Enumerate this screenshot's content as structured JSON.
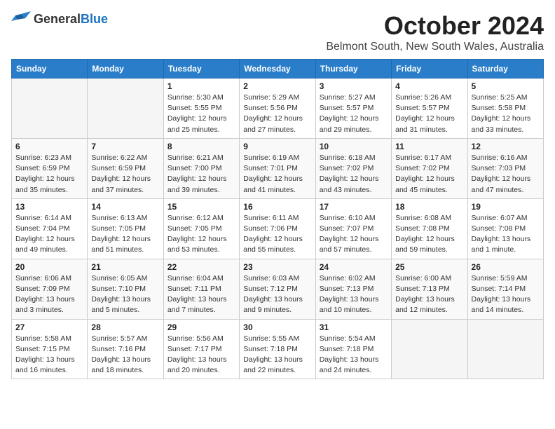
{
  "header": {
    "logo_general": "General",
    "logo_blue": "Blue",
    "title": "October 2024",
    "subtitle": "Belmont South, New South Wales, Australia"
  },
  "days_of_week": [
    "Sunday",
    "Monday",
    "Tuesday",
    "Wednesday",
    "Thursday",
    "Friday",
    "Saturday"
  ],
  "weeks": [
    [
      {
        "day": "",
        "sunrise": "",
        "sunset": "",
        "daylight": ""
      },
      {
        "day": "",
        "sunrise": "",
        "sunset": "",
        "daylight": ""
      },
      {
        "day": "1",
        "sunrise": "Sunrise: 5:30 AM",
        "sunset": "Sunset: 5:55 PM",
        "daylight": "Daylight: 12 hours and 25 minutes."
      },
      {
        "day": "2",
        "sunrise": "Sunrise: 5:29 AM",
        "sunset": "Sunset: 5:56 PM",
        "daylight": "Daylight: 12 hours and 27 minutes."
      },
      {
        "day": "3",
        "sunrise": "Sunrise: 5:27 AM",
        "sunset": "Sunset: 5:57 PM",
        "daylight": "Daylight: 12 hours and 29 minutes."
      },
      {
        "day": "4",
        "sunrise": "Sunrise: 5:26 AM",
        "sunset": "Sunset: 5:57 PM",
        "daylight": "Daylight: 12 hours and 31 minutes."
      },
      {
        "day": "5",
        "sunrise": "Sunrise: 5:25 AM",
        "sunset": "Sunset: 5:58 PM",
        "daylight": "Daylight: 12 hours and 33 minutes."
      }
    ],
    [
      {
        "day": "6",
        "sunrise": "Sunrise: 6:23 AM",
        "sunset": "Sunset: 6:59 PM",
        "daylight": "Daylight: 12 hours and 35 minutes."
      },
      {
        "day": "7",
        "sunrise": "Sunrise: 6:22 AM",
        "sunset": "Sunset: 6:59 PM",
        "daylight": "Daylight: 12 hours and 37 minutes."
      },
      {
        "day": "8",
        "sunrise": "Sunrise: 6:21 AM",
        "sunset": "Sunset: 7:00 PM",
        "daylight": "Daylight: 12 hours and 39 minutes."
      },
      {
        "day": "9",
        "sunrise": "Sunrise: 6:19 AM",
        "sunset": "Sunset: 7:01 PM",
        "daylight": "Daylight: 12 hours and 41 minutes."
      },
      {
        "day": "10",
        "sunrise": "Sunrise: 6:18 AM",
        "sunset": "Sunset: 7:02 PM",
        "daylight": "Daylight: 12 hours and 43 minutes."
      },
      {
        "day": "11",
        "sunrise": "Sunrise: 6:17 AM",
        "sunset": "Sunset: 7:02 PM",
        "daylight": "Daylight: 12 hours and 45 minutes."
      },
      {
        "day": "12",
        "sunrise": "Sunrise: 6:16 AM",
        "sunset": "Sunset: 7:03 PM",
        "daylight": "Daylight: 12 hours and 47 minutes."
      }
    ],
    [
      {
        "day": "13",
        "sunrise": "Sunrise: 6:14 AM",
        "sunset": "Sunset: 7:04 PM",
        "daylight": "Daylight: 12 hours and 49 minutes."
      },
      {
        "day": "14",
        "sunrise": "Sunrise: 6:13 AM",
        "sunset": "Sunset: 7:05 PM",
        "daylight": "Daylight: 12 hours and 51 minutes."
      },
      {
        "day": "15",
        "sunrise": "Sunrise: 6:12 AM",
        "sunset": "Sunset: 7:05 PM",
        "daylight": "Daylight: 12 hours and 53 minutes."
      },
      {
        "day": "16",
        "sunrise": "Sunrise: 6:11 AM",
        "sunset": "Sunset: 7:06 PM",
        "daylight": "Daylight: 12 hours and 55 minutes."
      },
      {
        "day": "17",
        "sunrise": "Sunrise: 6:10 AM",
        "sunset": "Sunset: 7:07 PM",
        "daylight": "Daylight: 12 hours and 57 minutes."
      },
      {
        "day": "18",
        "sunrise": "Sunrise: 6:08 AM",
        "sunset": "Sunset: 7:08 PM",
        "daylight": "Daylight: 12 hours and 59 minutes."
      },
      {
        "day": "19",
        "sunrise": "Sunrise: 6:07 AM",
        "sunset": "Sunset: 7:08 PM",
        "daylight": "Daylight: 13 hours and 1 minute."
      }
    ],
    [
      {
        "day": "20",
        "sunrise": "Sunrise: 6:06 AM",
        "sunset": "Sunset: 7:09 PM",
        "daylight": "Daylight: 13 hours and 3 minutes."
      },
      {
        "day": "21",
        "sunrise": "Sunrise: 6:05 AM",
        "sunset": "Sunset: 7:10 PM",
        "daylight": "Daylight: 13 hours and 5 minutes."
      },
      {
        "day": "22",
        "sunrise": "Sunrise: 6:04 AM",
        "sunset": "Sunset: 7:11 PM",
        "daylight": "Daylight: 13 hours and 7 minutes."
      },
      {
        "day": "23",
        "sunrise": "Sunrise: 6:03 AM",
        "sunset": "Sunset: 7:12 PM",
        "daylight": "Daylight: 13 hours and 9 minutes."
      },
      {
        "day": "24",
        "sunrise": "Sunrise: 6:02 AM",
        "sunset": "Sunset: 7:13 PM",
        "daylight": "Daylight: 13 hours and 10 minutes."
      },
      {
        "day": "25",
        "sunrise": "Sunrise: 6:00 AM",
        "sunset": "Sunset: 7:13 PM",
        "daylight": "Daylight: 13 hours and 12 minutes."
      },
      {
        "day": "26",
        "sunrise": "Sunrise: 5:59 AM",
        "sunset": "Sunset: 7:14 PM",
        "daylight": "Daylight: 13 hours and 14 minutes."
      }
    ],
    [
      {
        "day": "27",
        "sunrise": "Sunrise: 5:58 AM",
        "sunset": "Sunset: 7:15 PM",
        "daylight": "Daylight: 13 hours and 16 minutes."
      },
      {
        "day": "28",
        "sunrise": "Sunrise: 5:57 AM",
        "sunset": "Sunset: 7:16 PM",
        "daylight": "Daylight: 13 hours and 18 minutes."
      },
      {
        "day": "29",
        "sunrise": "Sunrise: 5:56 AM",
        "sunset": "Sunset: 7:17 PM",
        "daylight": "Daylight: 13 hours and 20 minutes."
      },
      {
        "day": "30",
        "sunrise": "Sunrise: 5:55 AM",
        "sunset": "Sunset: 7:18 PM",
        "daylight": "Daylight: 13 hours and 22 minutes."
      },
      {
        "day": "31",
        "sunrise": "Sunrise: 5:54 AM",
        "sunset": "Sunset: 7:18 PM",
        "daylight": "Daylight: 13 hours and 24 minutes."
      },
      {
        "day": "",
        "sunrise": "",
        "sunset": "",
        "daylight": ""
      },
      {
        "day": "",
        "sunrise": "",
        "sunset": "",
        "daylight": ""
      }
    ]
  ]
}
